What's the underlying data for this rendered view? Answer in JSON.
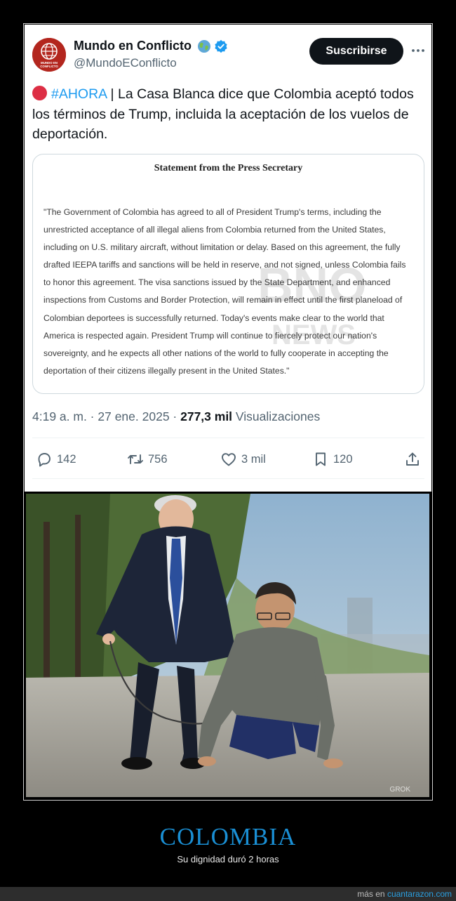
{
  "tweet": {
    "author_name": "Mundo en Conflicto",
    "avatar_text": "MUNDO EN CONFLICTO",
    "handle": "@MundoEConflicto",
    "subscribe_label": "Suscribirse",
    "hashtag": "#AHORA",
    "text": " | La Casa Blanca dice que Colombia aceptó todos los términos de Trump, incluida la aceptación de los vuelos de deportación.",
    "document": {
      "title": "Statement from the Press Secretary",
      "lines": [
        "\"The Government of Colombia has agreed to all of President Trump's terms, including the",
        "unrestricted acceptance of all illegal aliens from Colombia returned from the United States,",
        "including on U.S. military aircraft, without limitation or delay. Based on this agreement, the fully",
        "drafted IEEPA tariffs and sanctions will be held in reserve, and not signed, unless Colombia fails",
        "to honor this agreement. The visa sanctions issued by the State Department, and enhanced",
        "inspections from Customs and Border Protection, will remain in effect until the first planeload of",
        "Colombian deportees is successfully returned. Today's events make clear to the world that",
        "America is respected again. President Trump will continue to fiercely protect our nation's",
        "sovereignty, and he expects all other nations of the world to fully cooperate in accepting the",
        "deportation of their citizens illegally present in the United States.\""
      ]
    },
    "time": "4:19 a. m. · 27 ene. 2025 · ",
    "views_count": "277,3 mil",
    "views_label": " Visualizaciones",
    "actions": {
      "replies": "142",
      "reposts": "756",
      "likes": "3 mil",
      "bookmarks": "120"
    }
  },
  "photo": {
    "watermark": "GROK"
  },
  "caption": {
    "title": "COLOMBIA",
    "subtitle": "Su dignidad duró 2 horas"
  },
  "footer": {
    "prefix": "más en ",
    "site": "cuantarazon.com"
  },
  "colors": {
    "accent": "#1d9bf0",
    "caption_title": "#1a8fd4",
    "red_dot": "#dd2e44",
    "avatar_bg": "#b3261e"
  },
  "icons": {
    "globe": "globe-icon",
    "verified": "verified-badge-icon",
    "more": "more-options-icon",
    "reply": "reply-icon",
    "repost": "repost-icon",
    "like": "heart-icon",
    "bookmark": "bookmark-icon",
    "share": "share-icon"
  }
}
